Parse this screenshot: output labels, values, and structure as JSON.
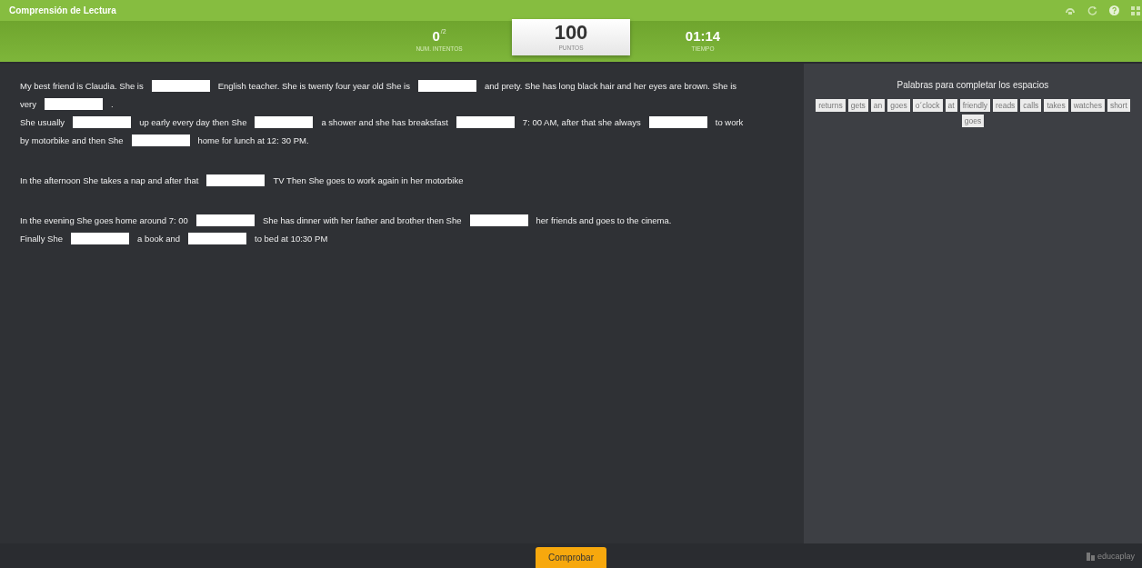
{
  "window": {
    "title": "Comprensión de Lectura"
  },
  "stats": {
    "attempts": {
      "value": "0",
      "max": "/2",
      "label": "NUM. INTENTOS"
    },
    "points": {
      "value": "100",
      "label": "PUNTOS"
    },
    "time": {
      "value": "01:14",
      "label": "TIEMPO"
    }
  },
  "paragraphs": [
    [
      [
        {
          "kind": "text",
          "text": "My best friend is Claudia. She is"
        },
        {
          "kind": "blank"
        },
        {
          "kind": "text",
          "text": "English teacher. She is twenty four year old She is"
        },
        {
          "kind": "blank"
        },
        {
          "kind": "text",
          "text": "and prety. She has long black hair and her eyes are brown. She is"
        }
      ],
      [
        {
          "kind": "text",
          "text": "very"
        },
        {
          "kind": "blank"
        },
        {
          "kind": "text",
          "text": "."
        }
      ],
      [
        {
          "kind": "text",
          "text": "She usually"
        },
        {
          "kind": "blank"
        },
        {
          "kind": "text",
          "text": "up early every day then She"
        },
        {
          "kind": "blank"
        },
        {
          "kind": "text",
          "text": "a shower and she has breaksfast"
        },
        {
          "kind": "blank"
        },
        {
          "kind": "text",
          "text": "7: 00 AM, after that she always"
        },
        {
          "kind": "blank"
        },
        {
          "kind": "text",
          "text": "to work"
        }
      ],
      [
        {
          "kind": "text",
          "text": "by motorbike and then She"
        },
        {
          "kind": "blank"
        },
        {
          "kind": "text",
          "text": "home for lunch at 12: 30 PM."
        }
      ]
    ],
    [
      [
        {
          "kind": "text",
          "text": "In the afternoon She takes a nap and after that"
        },
        {
          "kind": "blank"
        },
        {
          "kind": "text",
          "text": "TV Then She goes to work again in her motorbike"
        }
      ]
    ],
    [
      [
        {
          "kind": "text",
          "text": "In the evening She goes home around 7: 00"
        },
        {
          "kind": "blank"
        },
        {
          "kind": "text",
          "text": "She has dinner with her father and brother then She"
        },
        {
          "kind": "blank"
        },
        {
          "kind": "text",
          "text": "her friends and goes to the cinema."
        }
      ],
      [
        {
          "kind": "text",
          "text": "Finally She"
        },
        {
          "kind": "blank"
        },
        {
          "kind": "text",
          "text": "a book and"
        },
        {
          "kind": "blank"
        },
        {
          "kind": "text",
          "text": "to bed at 10:30 PM"
        }
      ]
    ]
  ],
  "word_bank": {
    "title": "Palabras para completar los espacios",
    "words": [
      "returns",
      "gets",
      "an",
      "goes",
      "o´clock",
      "at",
      "friendly",
      "reads",
      "calls",
      "takes",
      "watches",
      "short",
      "goes"
    ]
  },
  "footer": {
    "button": "Comprobar",
    "logo": "educaplay"
  }
}
